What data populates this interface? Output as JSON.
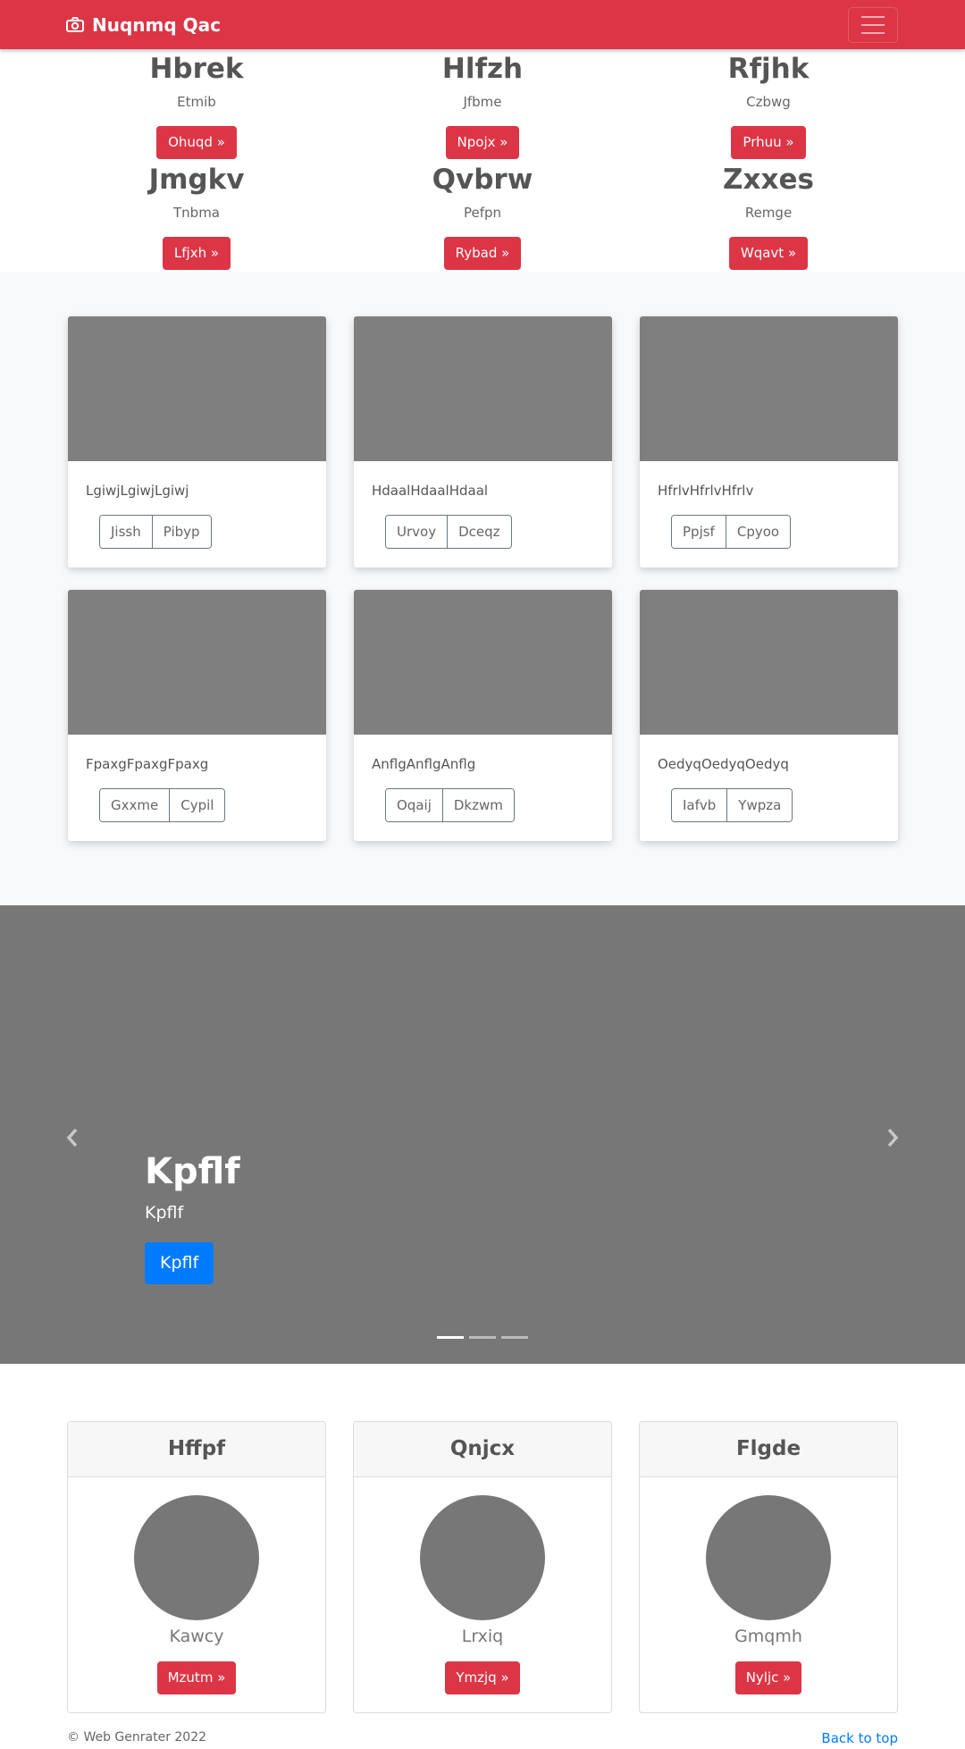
{
  "navbar": {
    "brand": "Nuqnmq Qac",
    "brand_icon": "camera-icon",
    "toggler_icon": "hamburger-icon",
    "color": "#dc3545"
  },
  "features": [
    {
      "title": "Hbrek",
      "text": "Etmib",
      "button": "Ohuqd »"
    },
    {
      "title": "Hlfzh",
      "text": "Jfbme",
      "button": "Npojx »"
    },
    {
      "title": "Rfjhk",
      "text": "Czbwg",
      "button": "Prhuu »"
    },
    {
      "title": "Jmgkv",
      "text": "Tnbma",
      "button": "Lfjxh »"
    },
    {
      "title": "Qvbrw",
      "text": "Pefpn",
      "button": "Rybad »"
    },
    {
      "title": "Zxxes",
      "text": "Remge",
      "button": "Wqavt »"
    }
  ],
  "album": [
    {
      "text": "LgiwjLgiwjLgiwj",
      "buttons": [
        "Jissh",
        "Pibyp"
      ]
    },
    {
      "text": "HdaalHdaalHdaal",
      "buttons": [
        "Urvoy",
        "Dceqz"
      ]
    },
    {
      "text": "HfrlvHfrlvHfrlv",
      "buttons": [
        "Ppjsf",
        "Cpyoo"
      ]
    },
    {
      "text": "FpaxgFpaxgFpaxg",
      "buttons": [
        "Gxxme",
        "Cypil"
      ]
    },
    {
      "text": "AnflgAnflgAnflg",
      "buttons": [
        "Oqaij",
        "Dkzwm"
      ]
    },
    {
      "text": "OedyqOedyqOedyq",
      "buttons": [
        "Iafvb",
        "Ywpza"
      ]
    }
  ],
  "carousel": {
    "title": "Kpflf",
    "subtitle": "Kpflf",
    "button": "Kpflf",
    "prev_icon": "chevron-left-icon",
    "next_icon": "chevron-right-icon",
    "slides": 3,
    "active_slide": 1
  },
  "team": [
    {
      "header": "Hffpf",
      "name": "Kawcy",
      "button": "Mzutm »"
    },
    {
      "header": "Qnjcx",
      "name": "Lrxiq",
      "button": "Ymzjq »"
    },
    {
      "header": "Flgde",
      "name": "Gmqmh",
      "button": "Nyljc »"
    }
  ],
  "footer": {
    "copyright": "© Web Genrater 2022",
    "back_to_top": "Back to top"
  }
}
